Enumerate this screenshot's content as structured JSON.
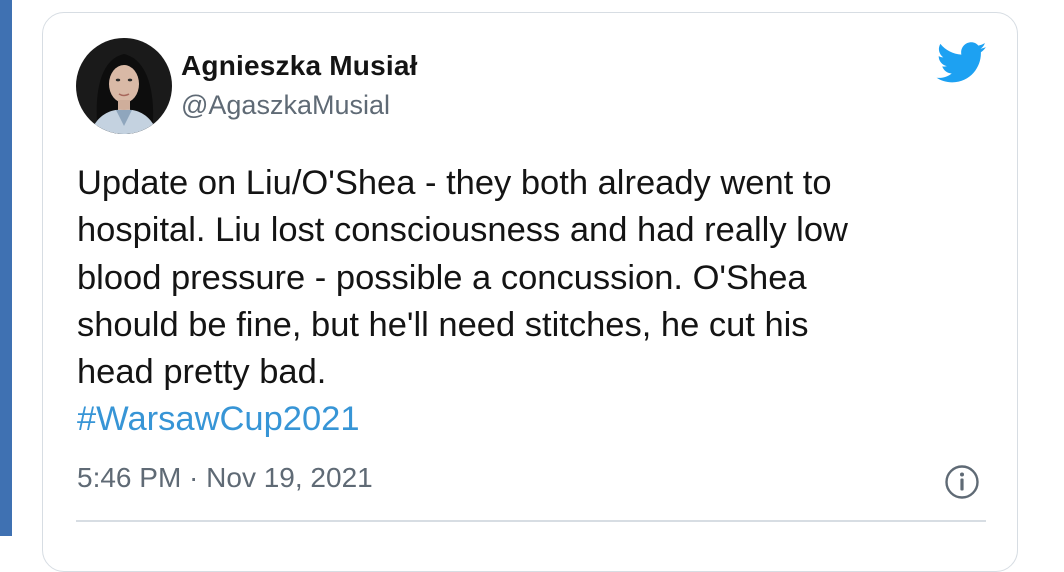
{
  "author": {
    "display_name": "Agnieszka Musiał",
    "handle": "@AgaszkaMusial",
    "avatar_icon": "user-avatar-photo"
  },
  "tweet": {
    "text_lines": [
      "Update on Liu/O'Shea - they both already went to",
      "hospital. Liu lost consciousness and had really low",
      "blood pressure - possible a concussion. O'Shea",
      "should be fine, but he'll need stitches, he cut his",
      "head pretty bad."
    ],
    "hashtag": "#WarsawCup2021",
    "timestamp": "5:46 PM · Nov 19, 2021"
  },
  "icons": {
    "brand": "twitter-bird-icon",
    "info": "info-icon"
  },
  "colors": {
    "accent_blue": "#1da1f2",
    "link_blue": "#3795d6",
    "text": "#141414",
    "secondary_text": "#5f6a75",
    "border": "#d7dde3",
    "left_rule": "#3f71b2"
  }
}
